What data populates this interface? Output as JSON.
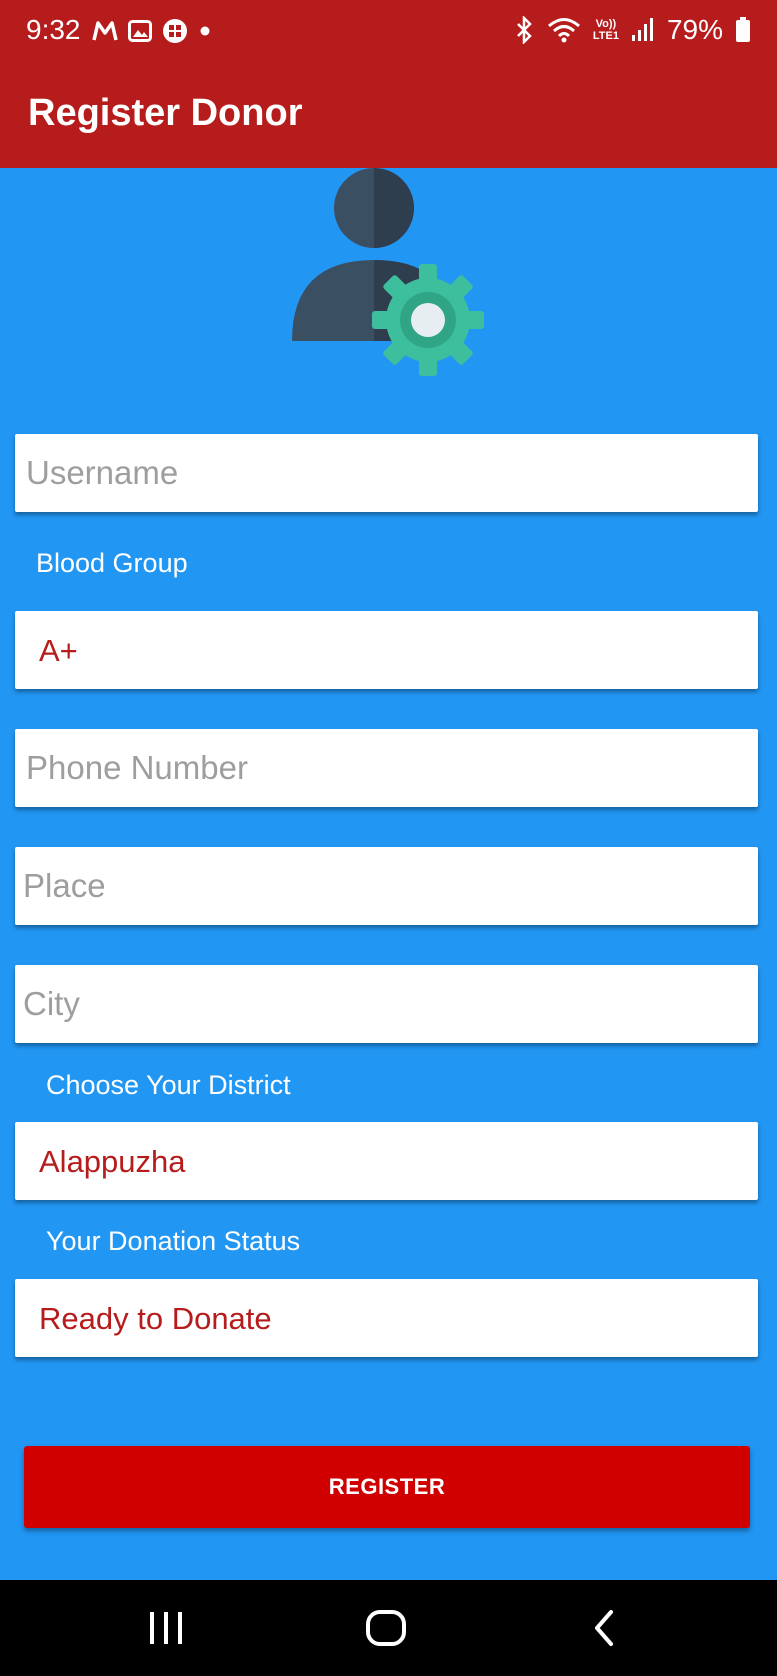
{
  "status_bar": {
    "time": "9:32",
    "battery": "79%",
    "icons": [
      "gmail-m-icon",
      "gallery-icon",
      "app-grid-icon",
      "dot-icon",
      "bluetooth-icon",
      "wifi-icon",
      "volte-icon",
      "signal-icon",
      "battery-icon"
    ],
    "volte_top": "Vo))",
    "volte_bottom": "LTE1"
  },
  "app_bar": {
    "title": "Register Donor"
  },
  "form": {
    "username_placeholder": "Username",
    "blood_group_label": "Blood Group",
    "blood_group_value": "A+",
    "phone_placeholder": "Phone Number",
    "place_placeholder": "Place",
    "city_placeholder": "City",
    "district_label": "Choose Your District",
    "district_value": "Alappuzha",
    "donation_status_label": "Your Donation Status",
    "donation_status_value": "Ready to Donate"
  },
  "register_button": {
    "label": "REGISTER"
  },
  "colors": {
    "app_bar": "#B71C1C",
    "background": "#2196F3",
    "button": "#D00000",
    "selected_text": "#B71C1C",
    "placeholder": "#9E9E9E"
  }
}
